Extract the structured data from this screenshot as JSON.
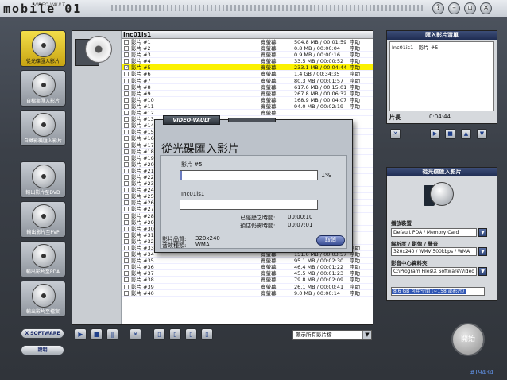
{
  "title_bar": {
    "brand": "mobile 01",
    "brand_small": "VIDEO-VAULT"
  },
  "sidebar": {
    "items": [
      {
        "label": "從光碟匯入影片",
        "active": true
      },
      {
        "label": "自檔案匯入影片",
        "active": false
      },
      {
        "label": "自攝影機匯入影片",
        "active": false
      },
      {
        "label": "輸出影片至DVD",
        "active": false
      },
      {
        "label": "輸出影片至PVP",
        "active": false
      },
      {
        "label": "輸出影片至PDA",
        "active": false
      },
      {
        "label": "輸出影片至檔案",
        "active": false
      }
    ],
    "x_software": "X SOFTWARE",
    "help": "說明"
  },
  "list": {
    "header": "Inc01is1",
    "rows": [
      {
        "name": "影片 #1",
        "format": "寬螢幕",
        "size": "504.8 MB / 00:01:59",
        "extra": "序助"
      },
      {
        "name": "影片 #2",
        "format": "寬螢幕",
        "size": "0.8 MB / 00:00:04",
        "extra": "序助"
      },
      {
        "name": "影片 #3",
        "format": "寬螢幕",
        "size": "0.9 MB / 00:00:16",
        "extra": "序助"
      },
      {
        "name": "影片 #4",
        "format": "寬螢幕",
        "size": "33.5 MB / 00:00:52",
        "extra": "序助"
      },
      {
        "name": "影片 #5",
        "format": "寬螢幕",
        "size": "233.1 MB / 00:04:44",
        "extra": "序助",
        "selected": true,
        "checked": true
      },
      {
        "name": "影片 #6",
        "format": "寬螢幕",
        "size": "1.4 GB / 00:34:35",
        "extra": "序助"
      },
      {
        "name": "影片 #7",
        "format": "寬螢幕",
        "size": "80.3 MB / 00:01:57",
        "extra": "序助"
      },
      {
        "name": "影片 #8",
        "format": "寬螢幕",
        "size": "617.6 MB / 00:15:01",
        "extra": "序助"
      },
      {
        "name": "影片 #9",
        "format": "寬螢幕",
        "size": "267.8 MB / 00:06:32",
        "extra": "序助"
      },
      {
        "name": "影片 #10",
        "format": "寬螢幕",
        "size": "168.9 MB / 00:04:07",
        "extra": "序助"
      },
      {
        "name": "影片 #11",
        "format": "寬螢幕",
        "size": "94.0 MB / 00:02:19",
        "extra": "序助"
      },
      {
        "name": "影片 #12",
        "format": "寬螢幕",
        "size": "",
        "extra": ""
      },
      {
        "name": "影片 #13",
        "format": "",
        "size": "",
        "extra": ""
      },
      {
        "name": "影片 #14",
        "format": "",
        "size": "",
        "extra": ""
      },
      {
        "name": "影片 #15",
        "format": "",
        "size": "",
        "extra": ""
      },
      {
        "name": "影片 #16",
        "format": "",
        "size": "",
        "extra": ""
      },
      {
        "name": "影片 #17",
        "format": "",
        "size": "",
        "extra": ""
      },
      {
        "name": "影片 #18",
        "format": "",
        "size": "",
        "extra": ""
      },
      {
        "name": "影片 #19",
        "format": "",
        "size": "",
        "extra": ""
      },
      {
        "name": "影片 #20",
        "format": "",
        "size": "",
        "extra": ""
      },
      {
        "name": "影片 #21",
        "format": "",
        "size": "",
        "extra": ""
      },
      {
        "name": "影片 #22",
        "format": "",
        "size": "",
        "extra": ""
      },
      {
        "name": "影片 #23",
        "format": "",
        "size": "",
        "extra": ""
      },
      {
        "name": "影片 #24",
        "format": "",
        "size": "",
        "extra": ""
      },
      {
        "name": "影片 #25",
        "format": "",
        "size": "",
        "extra": ""
      },
      {
        "name": "影片 #26",
        "format": "",
        "size": "",
        "extra": ""
      },
      {
        "name": "影片 #27",
        "format": "",
        "size": "",
        "extra": ""
      },
      {
        "name": "影片 #28",
        "format": "",
        "size": "",
        "extra": ""
      },
      {
        "name": "影片 #29",
        "format": "",
        "size": "",
        "extra": ""
      },
      {
        "name": "影片 #30",
        "format": "",
        "size": "",
        "extra": ""
      },
      {
        "name": "影片 #31",
        "format": "",
        "size": "",
        "extra": ""
      },
      {
        "name": "影片 #32",
        "format": "",
        "size": "",
        "extra": ""
      },
      {
        "name": "影片 #33",
        "format": "寬螢幕",
        "size": "247.5 MB / 00:04:42",
        "extra": "序助"
      },
      {
        "name": "影片 #34",
        "format": "寬螢幕",
        "size": "151.6 MB / 00:03:57",
        "extra": "序助"
      },
      {
        "name": "影片 #35",
        "format": "寬螢幕",
        "size": "95.1 MB / 00:02:30",
        "extra": "序助"
      },
      {
        "name": "影片 #36",
        "format": "寬螢幕",
        "size": "46.4 MB / 00:01:22",
        "extra": "序助"
      },
      {
        "name": "影片 #37",
        "format": "寬螢幕",
        "size": "45.5 MB / 00:01:23",
        "extra": "序助"
      },
      {
        "name": "影片 #38",
        "format": "寬螢幕",
        "size": "79.8 MB / 00:02:09",
        "extra": "序助"
      },
      {
        "name": "影片 #39",
        "format": "寬螢幕",
        "size": "26.1 MB / 00:00:41",
        "extra": "序助"
      },
      {
        "name": "影片 #40",
        "format": "寬螢幕",
        "size": "9.0 MB / 00:00:14",
        "extra": "序助"
      }
    ]
  },
  "toolbar": {
    "filter": "顯示所有影片檔"
  },
  "import_list": {
    "title": "匯入影片清單",
    "item": "Inc01is1 - 影片 #5",
    "duration": "0:04:44",
    "length_label": "片長"
  },
  "import_settings": {
    "title": "從光碟匯入影片",
    "device_label": "播放裝置",
    "device": "Default PDA / Memory Card",
    "resolution_label": "解析度 / 影像 / 聲音",
    "resolution": "320x240 / WMV 500kbps / WMA",
    "folder_label": "影音中心資料夾",
    "folder": "C:\\Program Files\\X Software\\Video",
    "space": "8.6 GB 可用空間 (~158 部影片)"
  },
  "start_label": "開始",
  "watermark": "#19434",
  "dialog": {
    "tab": "VIDEO-VAULT",
    "title": "從光碟匯入影片",
    "file_label": "影片 #5",
    "percent": "1%",
    "progress": 0.01,
    "disc_label": "Inc01is1",
    "elapsed_label": "已經歷之時間:",
    "elapsed": "00:00:10",
    "remaining_label": "預估仍需時間:",
    "remaining": "00:07:01",
    "quality_label": "影片品質:",
    "quality": "320x240",
    "audio_label": "音效種類:",
    "audio": "WMA",
    "cancel": "取消"
  }
}
